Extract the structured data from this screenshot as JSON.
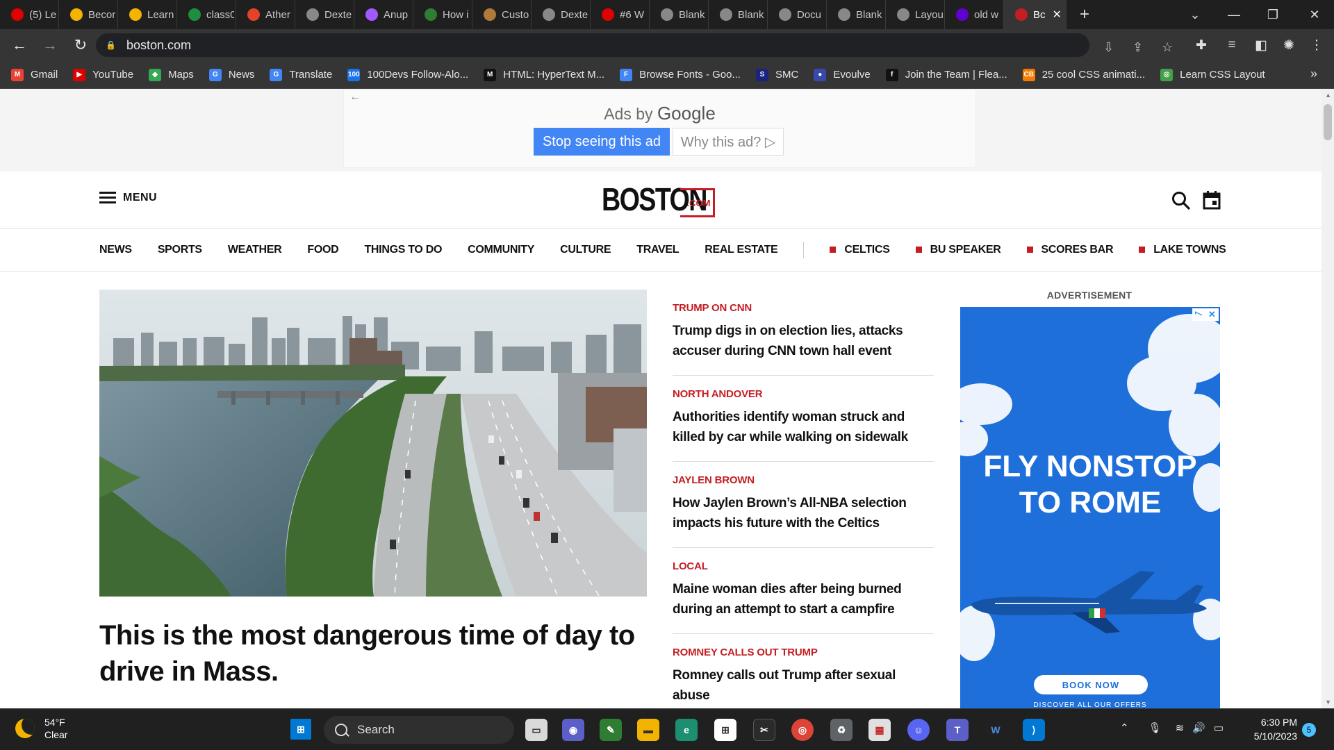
{
  "browser": {
    "tabs": [
      {
        "label": "(5) Le",
        "icon": "youtube-icon",
        "color": "#e00000"
      },
      {
        "label": "Becor",
        "icon": "smiley-icon",
        "color": "#f2b400"
      },
      {
        "label": "Learn",
        "icon": "smiley-icon",
        "color": "#f2b400"
      },
      {
        "label": "class0",
        "icon": "drive-icon",
        "color": "#1e8e3e"
      },
      {
        "label": "Ather",
        "icon": "gitlab-icon",
        "color": "#e24329"
      },
      {
        "label": "Dexte",
        "icon": "globe-icon",
        "color": "#888888"
      },
      {
        "label": "Anup",
        "icon": "figma-icon",
        "color": "#a259ff"
      },
      {
        "label": "How i",
        "icon": "link-icon",
        "color": "#2e7d32"
      },
      {
        "label": "Custo",
        "icon": "cookie-icon",
        "color": "#b07a3a"
      },
      {
        "label": "Dexte",
        "icon": "globe-icon",
        "color": "#888888"
      },
      {
        "label": "#6 W",
        "icon": "youtube-icon",
        "color": "#e00000"
      },
      {
        "label": "Blank",
        "icon": "globe-icon",
        "color": "#888888"
      },
      {
        "label": "Blank",
        "icon": "globe-icon",
        "color": "#888888"
      },
      {
        "label": "Docu",
        "icon": "globe-icon",
        "color": "#888888"
      },
      {
        "label": "Blank",
        "icon": "globe-icon",
        "color": "#888888"
      },
      {
        "label": "Layou",
        "icon": "globe-icon",
        "color": "#888888"
      },
      {
        "label": "old w",
        "icon": "yahoo-icon",
        "color": "#6001d2"
      },
      {
        "label": "Bc",
        "icon": "boston-icon",
        "color": "#c41e24",
        "active": true
      }
    ],
    "new_tab": "+",
    "url": "boston.com",
    "bookmarks": [
      {
        "label": "Gmail",
        "icon": "gmail-icon",
        "color": "#ea4335",
        "glyph": "M"
      },
      {
        "label": "YouTube",
        "icon": "youtube-icon",
        "color": "#e00000",
        "glyph": "▶"
      },
      {
        "label": "Maps",
        "icon": "maps-icon",
        "color": "#34a853",
        "glyph": "◆"
      },
      {
        "label": "News",
        "icon": "google-news-icon",
        "color": "#4285f4",
        "glyph": "G"
      },
      {
        "label": "Translate",
        "icon": "translate-icon",
        "color": "#4285f4",
        "glyph": "G"
      },
      {
        "label": "100Devs Follow-Alo...",
        "icon": "100devs-icon",
        "color": "#1a73e8",
        "glyph": "100"
      },
      {
        "label": "HTML: HyperText M...",
        "icon": "mdn-icon",
        "color": "#111111",
        "glyph": "M"
      },
      {
        "label": "Browse Fonts - Goo...",
        "icon": "google-fonts-icon",
        "color": "#4285f4",
        "glyph": "F"
      },
      {
        "label": "SMC",
        "icon": "smc-icon",
        "color": "#1a237e",
        "glyph": "S"
      },
      {
        "label": "Evoulve",
        "icon": "evolve-icon",
        "color": "#3949ab",
        "glyph": "●"
      },
      {
        "label": "Join the Team | Flea...",
        "icon": "facebook-icon",
        "color": "#111111",
        "glyph": "f"
      },
      {
        "label": "25 cool CSS animati...",
        "icon": "css-icon",
        "color": "#f57c00",
        "glyph": "CB"
      },
      {
        "label": "Learn CSS Layout",
        "icon": "globe-icon",
        "color": "#43a047",
        "glyph": "◎"
      }
    ]
  },
  "ad_strip": {
    "ads_by": "Ads by",
    "google": "Google",
    "stop_label": "Stop seeing this ad",
    "why_label": "Why this ad? ▷"
  },
  "site": {
    "menu_label": "MENU",
    "logo": "BOSTON",
    "logo_suffix": ".COM",
    "brand_color": "#c41e24",
    "nav": [
      "NEWS",
      "SPORTS",
      "WEATHER",
      "FOOD",
      "THINGS TO DO",
      "COMMUNITY",
      "CULTURE",
      "TRAVEL",
      "REAL ESTATE"
    ],
    "nav_tags": [
      "CELTICS",
      "BU SPEAKER",
      "SCORES BAR",
      "LAKE TOWNS"
    ]
  },
  "hero": {
    "headline": "This is the most dangerous time of day to drive in Mass."
  },
  "stories": [
    {
      "kicker": "TRUMP ON CNN",
      "title": "Trump digs in on election lies, attacks accuser during CNN town hall event"
    },
    {
      "kicker": "NORTH ANDOVER",
      "title": "Authorities identify woman struck and killed by car while walking on sidewalk"
    },
    {
      "kicker": "JAYLEN BROWN",
      "title": "How Jaylen Brown’s All-NBA selection impacts his future with the Celtics"
    },
    {
      "kicker": "LOCAL",
      "title": "Maine woman dies after being burned during an attempt to start a campfire"
    },
    {
      "kicker": "ROMNEY CALLS OUT TRUMP",
      "title": "Romney calls out Trump after sexual abuse"
    }
  ],
  "side_ad": {
    "label": "ADVERTISEMENT",
    "headline": "FLY NONSTOP TO ROME",
    "cta": "BOOK NOW",
    "footer": "DISCOVER ALL OUR OFFERS",
    "bg_color": "#1e6fd9"
  },
  "taskbar": {
    "temp": "54°F",
    "condition": "Clear",
    "search_label": "Search",
    "time": "6:30 PM",
    "date": "5/10/2023",
    "notifications": "5"
  }
}
